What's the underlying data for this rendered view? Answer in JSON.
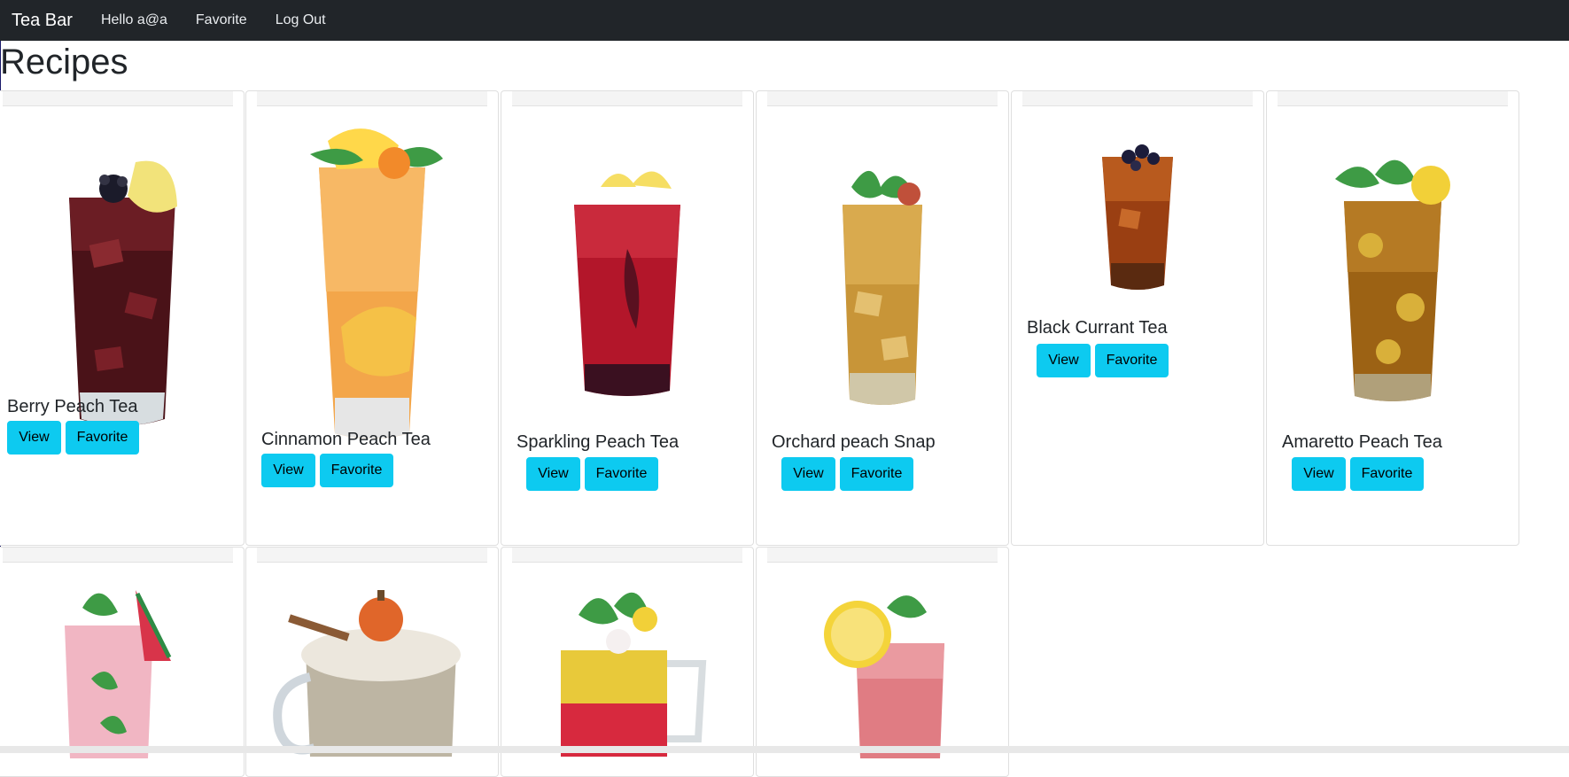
{
  "navbar": {
    "brand": "Tea Bar",
    "links": [
      "Hello a@a",
      "Favorite",
      "Log Out"
    ]
  },
  "page_title": "Recipes",
  "buttons": {
    "view_label": "View",
    "favorite_label": "Favorite"
  },
  "recipes": [
    "Berry Peach Tea",
    "Cinnamon Peach Tea",
    "Sparkling Peach Tea",
    "Orchard peach Snap",
    "Black Currant Tea",
    "Amaretto Peach Tea"
  ],
  "colors": {
    "navbar_bg": "#212529",
    "button_bg": "#0dcaf0"
  }
}
